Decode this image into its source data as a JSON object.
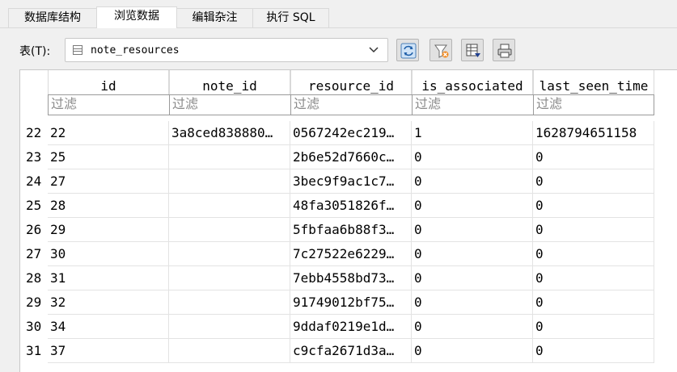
{
  "tabs": [
    {
      "label": "数据库结构",
      "active": false
    },
    {
      "label": "浏览数据",
      "active": true
    },
    {
      "label": "编辑杂注",
      "active": false
    },
    {
      "label": "执行 SQL",
      "active": false
    }
  ],
  "toolbar": {
    "table_label": "表(T):",
    "selected_table": "note_resources",
    "buttons": [
      {
        "name": "refresh-button",
        "icon": "refresh-icon"
      },
      {
        "name": "clear-filters-button",
        "icon": "clear-filter-icon"
      },
      {
        "name": "save-filter-button",
        "icon": "save-table-icon"
      },
      {
        "name": "print-button",
        "icon": "print-icon"
      }
    ]
  },
  "grid": {
    "columns": [
      "id",
      "note_id",
      "resource_id",
      "is_associated",
      "last_seen_time"
    ],
    "filter_placeholder": "过滤",
    "rows": [
      {
        "num": "22",
        "cells": [
          "22",
          "3a8ced838880…",
          "0567242ec219…",
          "1",
          "1628794651158"
        ]
      },
      {
        "num": "23",
        "cells": [
          "25",
          "",
          "2b6e52d7660c…",
          "0",
          "0"
        ]
      },
      {
        "num": "24",
        "cells": [
          "27",
          "",
          "3bec9f9ac1c7…",
          "0",
          "0"
        ]
      },
      {
        "num": "25",
        "cells": [
          "28",
          "",
          "48fa3051826f…",
          "0",
          "0"
        ]
      },
      {
        "num": "26",
        "cells": [
          "29",
          "",
          "5fbfaa6b88f3…",
          "0",
          "0"
        ]
      },
      {
        "num": "27",
        "cells": [
          "30",
          "",
          "7c27522e6229…",
          "0",
          "0"
        ]
      },
      {
        "num": "28",
        "cells": [
          "31",
          "",
          "7ebb4558bd73…",
          "0",
          "0"
        ]
      },
      {
        "num": "29",
        "cells": [
          "32",
          "",
          "91749012bf75…",
          "0",
          "0"
        ]
      },
      {
        "num": "30",
        "cells": [
          "34",
          "",
          "9ddaf0219e1d…",
          "0",
          "0"
        ]
      },
      {
        "num": "31",
        "cells": [
          "37",
          "",
          "c9cfa2671d3a…",
          "0",
          "0"
        ]
      }
    ]
  }
}
